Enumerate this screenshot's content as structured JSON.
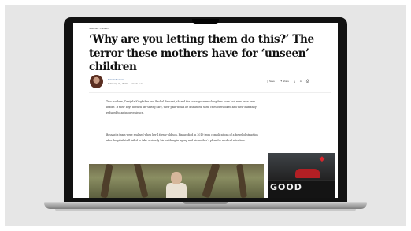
{
  "article": {
    "breadcrumb": "National · Children",
    "headline": "‘Why are you letting them do this?’ The terror these mothers have for ‘unseen’ children",
    "author": "Kate Aubusson",
    "date": "February 24, 2023 — 12 min read",
    "actions": {
      "save": "Save",
      "share": "Share",
      "text_size": "A"
    },
    "paragraphs": [
      "Two mothers, Danijela Kingfisher and Rachel Bessant, shared the same gut-wrenching fear none had ever been seen before. If their boys needed life-saving care, their pain would be dismissed, their cries overlooked and their humanity reduced to an inconvenience.",
      "Bessant’s fears were realised when her 16-year-old son, Finlay, died in 2019 from complications of a bowel obstruction after hospital staff failed to take seriously his writhing in agony and his mother’s pleas for medical attention."
    ]
  },
  "ad": {
    "text": "GOOD",
    "logo": "mitsubishi-logo"
  },
  "colors": {
    "backdrop": "#e6e6e6",
    "bezel": "#121212",
    "byline": "#1c4f8f",
    "ad_accent": "#d9262c"
  }
}
